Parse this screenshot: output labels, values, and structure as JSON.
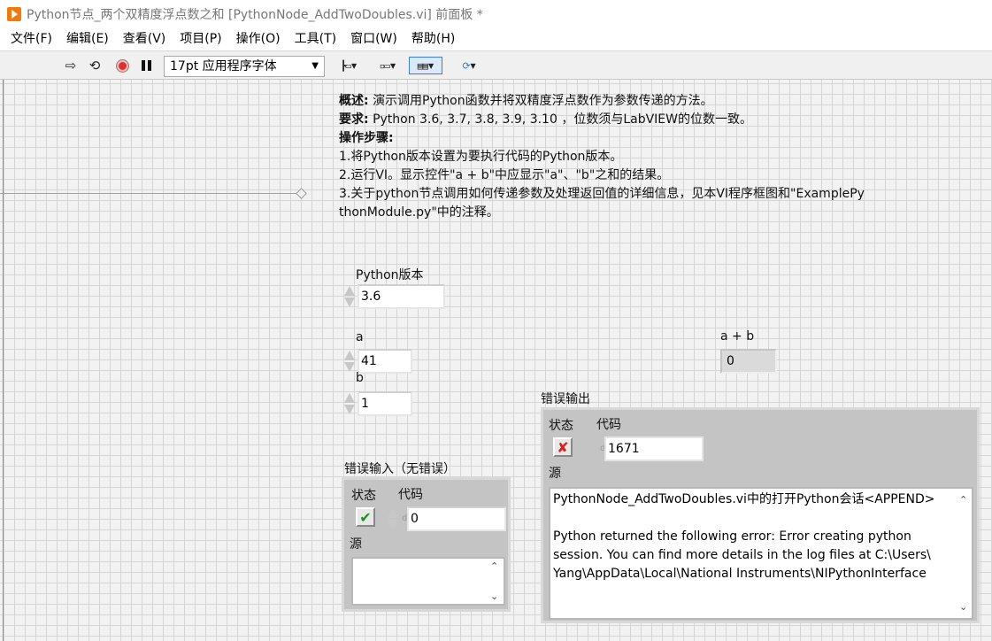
{
  "window": {
    "title": "Python节点_两个双精度浮点数之和 [PythonNode_AddTwoDoubles.vi] 前面板 *"
  },
  "menu": [
    "文件(F)",
    "编辑(E)",
    "查看(V)",
    "项目(P)",
    "操作(O)",
    "工具(T)",
    "窗口(W)",
    "帮助(H)"
  ],
  "toolbar": {
    "font_setting": "17pt 应用程序字体",
    "icons": [
      "run-arrow-icon",
      "run-continuously-icon",
      "abort-icon",
      "pause-icon",
      "align-icon",
      "distribute-icon",
      "resize-icon",
      "reorder-icon"
    ]
  },
  "description": {
    "overview_label": "概述:",
    "overview": "演示调用Python函数并将双精度浮点数作为参数传递的方法。",
    "requirement_label": "要求:",
    "requirement": "Python 3.6, 3.7, 3.8, 3.9, 3.10 ，位数须与LabVIEW的位数一致。",
    "steps_label": "操作步骤:",
    "step1": "1.将Python版本设置为要执行代码的Python版本。",
    "step2": "2.运行VI。显示控件\"a + b\"中应显示\"a\"、\"b\"之和的结果。",
    "step3a": "3.关于python节点调用如何传递参数及处理返回值的详细信息，见本VI程序框图和\"ExamplePy",
    "step3b": "thonModule.py\"中的注释。"
  },
  "controls": {
    "python_version": {
      "label": "Python版本",
      "value": "3.6"
    },
    "a": {
      "label": "a",
      "value": "41"
    },
    "b": {
      "label": "b",
      "value": "1"
    },
    "sum": {
      "label": "a + b",
      "value": "0"
    }
  },
  "error_in": {
    "label": "错误输入（无错误）",
    "status_label": "状态",
    "code_label": "代码",
    "code": "0",
    "source_label": "源",
    "source": "",
    "status_ok": true
  },
  "error_out": {
    "label": "错误输出",
    "status_label": "状态",
    "code_label": "代码",
    "code": "1671",
    "source_label": "源",
    "source_line1": "PythonNode_AddTwoDoubles.vi中的打开Python会话<APPEND>",
    "source_line2": "Python returned the following error: Error creating python",
    "source_line3": "session. You can find more details in the log files at C:\\Users\\",
    "source_line4": "Yang\\AppData\\Local\\National Instruments\\NIPythonInterface",
    "status_ok": false
  },
  "colors": {
    "title_icon": "#f07a10",
    "ok": "#1f8f1f",
    "error": "#d82020"
  }
}
